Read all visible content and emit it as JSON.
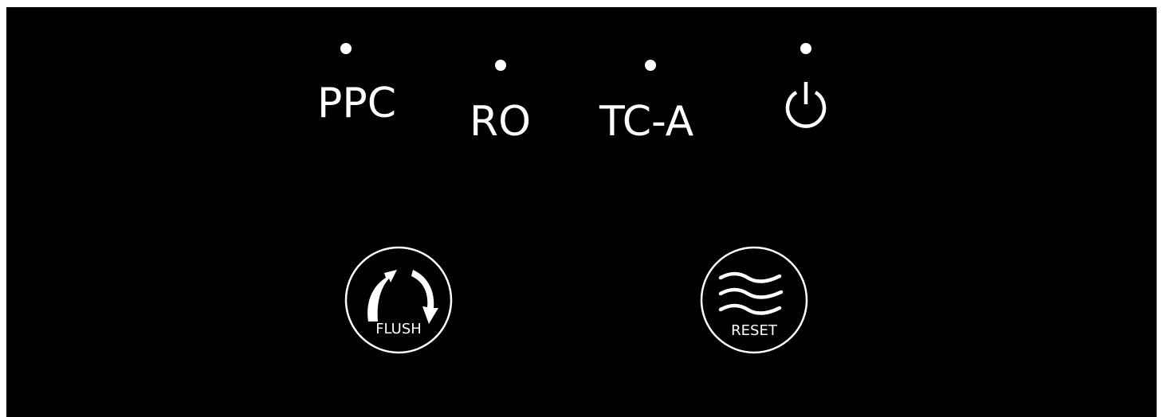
{
  "panel": {
    "background": "#000000",
    "foreground": "#ffffff",
    "indicators": [
      {
        "label": "PPC",
        "icon": "indicator-dot"
      },
      {
        "label": "RO",
        "icon": "indicator-dot"
      },
      {
        "label": "TC-A",
        "icon": "indicator-dot"
      },
      {
        "label": "",
        "icon": "power-icon"
      }
    ],
    "buttons": {
      "flush": {
        "label": "FLUSH",
        "icon": "flush-arrows-icon"
      },
      "reset": {
        "label": "RESET",
        "icon": "wave-lines-icon"
      }
    }
  }
}
